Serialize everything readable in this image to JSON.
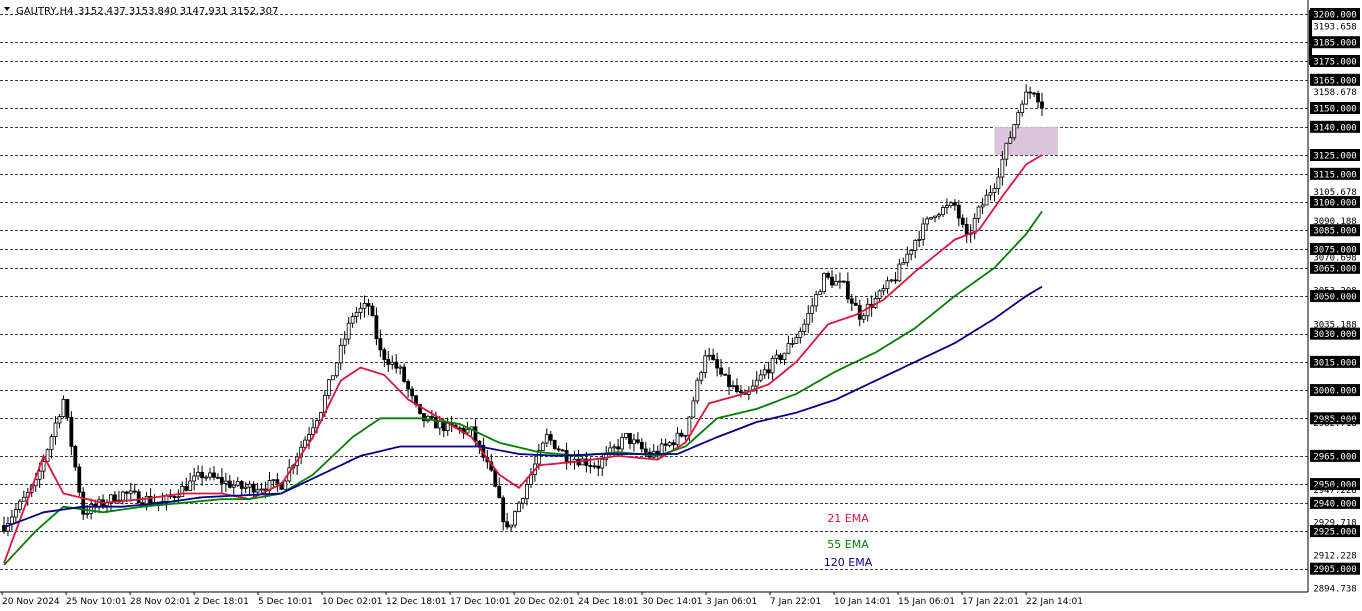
{
  "header": {
    "symbol": "GAUTRY,H4",
    "ohlc": "3152.437 3153.840 3147.931 3152.307"
  },
  "colors": {
    "ema21": "#dc143c",
    "ema55": "#008000",
    "ema120": "#00008b",
    "candle": "#000000",
    "zone": "#d8bfd8",
    "grid": "#000000",
    "axis_label_bg": "#000000"
  },
  "chart_data": {
    "type": "candlestick",
    "title": "GAUTRY,H4",
    "ylim": [
      2894.738,
      3200.0
    ],
    "grid": true,
    "x_tick_labels": [
      "20 Nov 2024",
      "25 Nov 10:01",
      "28 Nov 02:01",
      "2 Dec 18:01",
      "5 Dec 10:01",
      "10 Dec 02:01",
      "12 Dec 18:01",
      "17 Dec 10:01",
      "20 Dec 02:01",
      "24 Dec 18:01",
      "30 Dec 14:01",
      "3 Jan 06:01",
      "7 Jan 22:01",
      "10 Jan 14:01",
      "15 Jan 06:01",
      "17 Jan 22:01",
      "22 Jan 14:01"
    ],
    "level_lines": [
      3200,
      3185,
      3175,
      3165,
      3150,
      3140,
      3125,
      3115,
      3100,
      3085,
      3075,
      3065,
      3050,
      3030,
      3015,
      3000,
      2985,
      2965,
      2950,
      2940,
      2925,
      2905
    ],
    "highlighted_labels": [
      "3200.000",
      "3185.000",
      "3175.000",
      "3165.000",
      "3150.000",
      "3140.000",
      "3125.000",
      "3115.000",
      "3100.000",
      "3085.000",
      "3075.000",
      "3065.000",
      "3050.000",
      "3030.000",
      "3015.000",
      "3000.000",
      "2985.000",
      "2965.000",
      "2950.000",
      "2940.000",
      "2925.000",
      "2905.000"
    ],
    "plain_labels": [
      "3193.658",
      "3158.678",
      "3105.678",
      "3090.188",
      "3070.698",
      "3053.208",
      "3035.188",
      "2982.718",
      "2947.228",
      "2929.718",
      "2912.228",
      "2894.738"
    ],
    "price_key_points": [
      [
        0,
        2928
      ],
      [
        8,
        2950
      ],
      [
        15,
        2995
      ],
      [
        20,
        2935
      ],
      [
        30,
        2945
      ],
      [
        40,
        2940
      ],
      [
        50,
        2955
      ],
      [
        60,
        2948
      ],
      [
        70,
        2950
      ],
      [
        80,
        2990
      ],
      [
        88,
        3040
      ],
      [
        92,
        3045
      ],
      [
        95,
        3020
      ],
      [
        100,
        3010
      ],
      [
        105,
        2985
      ],
      [
        112,
        2980
      ],
      [
        118,
        2978
      ],
      [
        123,
        2955
      ],
      [
        127,
        2925
      ],
      [
        132,
        2950
      ],
      [
        137,
        2975
      ],
      [
        142,
        2965
      ],
      [
        150,
        2960
      ],
      [
        157,
        2975
      ],
      [
        163,
        2965
      ],
      [
        167,
        2970
      ],
      [
        172,
        2978
      ],
      [
        177,
        3020
      ],
      [
        182,
        3005
      ],
      [
        187,
        2995
      ],
      [
        192,
        3010
      ],
      [
        197,
        3020
      ],
      [
        202,
        3035
      ],
      [
        207,
        3060
      ],
      [
        212,
        3055
      ],
      [
        216,
        3040
      ],
      [
        220,
        3048
      ],
      [
        225,
        3060
      ],
      [
        230,
        3080
      ],
      [
        235,
        3095
      ],
      [
        240,
        3098
      ],
      [
        243,
        3080
      ],
      [
        246,
        3095
      ],
      [
        250,
        3110
      ],
      [
        254,
        3135
      ],
      [
        257,
        3155
      ],
      [
        260,
        3160
      ],
      [
        262,
        3152
      ]
    ],
    "ema_key_points": {
      "21 EMA": [
        [
          0,
          2908
        ],
        [
          10,
          2965
        ],
        [
          15,
          2945
        ],
        [
          25,
          2940
        ],
        [
          35,
          2942
        ],
        [
          45,
          2945
        ],
        [
          55,
          2945
        ],
        [
          62,
          2942
        ],
        [
          70,
          2950
        ],
        [
          78,
          2975
        ],
        [
          85,
          3005
        ],
        [
          90,
          3012
        ],
        [
          96,
          3008
        ],
        [
          102,
          2995
        ],
        [
          110,
          2985
        ],
        [
          118,
          2975
        ],
        [
          125,
          2955
        ],
        [
          130,
          2948
        ],
        [
          135,
          2960
        ],
        [
          145,
          2962
        ],
        [
          155,
          2965
        ],
        [
          165,
          2963
        ],
        [
          172,
          2972
        ],
        [
          178,
          2993
        ],
        [
          185,
          2997
        ],
        [
          193,
          3003
        ],
        [
          200,
          3015
        ],
        [
          208,
          3035
        ],
        [
          215,
          3040
        ],
        [
          222,
          3048
        ],
        [
          230,
          3063
        ],
        [
          240,
          3080
        ],
        [
          246,
          3085
        ],
        [
          252,
          3103
        ],
        [
          258,
          3120
        ],
        [
          262,
          3125
        ]
      ],
      "55 EMA": [
        [
          0,
          2907
        ],
        [
          8,
          2925
        ],
        [
          15,
          2938
        ],
        [
          25,
          2935
        ],
        [
          35,
          2938
        ],
        [
          45,
          2940
        ],
        [
          55,
          2942
        ],
        [
          62,
          2942
        ],
        [
          70,
          2945
        ],
        [
          78,
          2955
        ],
        [
          88,
          2975
        ],
        [
          95,
          2985
        ],
        [
          105,
          2985
        ],
        [
          115,
          2982
        ],
        [
          125,
          2972
        ],
        [
          135,
          2967
        ],
        [
          145,
          2965
        ],
        [
          155,
          2967
        ],
        [
          165,
          2965
        ],
        [
          172,
          2970
        ],
        [
          180,
          2985
        ],
        [
          190,
          2990
        ],
        [
          200,
          2998
        ],
        [
          210,
          3010
        ],
        [
          220,
          3020
        ],
        [
          230,
          3033
        ],
        [
          240,
          3050
        ],
        [
          250,
          3065
        ],
        [
          258,
          3083
        ],
        [
          262,
          3095
        ]
      ],
      "120 EMA": [
        [
          0,
          2927
        ],
        [
          10,
          2935
        ],
        [
          20,
          2938
        ],
        [
          30,
          2938
        ],
        [
          40,
          2940
        ],
        [
          50,
          2943
        ],
        [
          60,
          2944
        ],
        [
          70,
          2945
        ],
        [
          80,
          2955
        ],
        [
          90,
          2965
        ],
        [
          100,
          2970
        ],
        [
          110,
          2970
        ],
        [
          120,
          2970
        ],
        [
          130,
          2966
        ],
        [
          140,
          2965
        ],
        [
          150,
          2966
        ],
        [
          160,
          2966
        ],
        [
          170,
          2966
        ],
        [
          180,
          2975
        ],
        [
          190,
          2983
        ],
        [
          200,
          2988
        ],
        [
          210,
          2995
        ],
        [
          220,
          3005
        ],
        [
          230,
          3015
        ],
        [
          240,
          3025
        ],
        [
          250,
          3038
        ],
        [
          258,
          3050
        ],
        [
          262,
          3055
        ]
      ]
    },
    "zone": {
      "x_from": 250,
      "x_to": 266,
      "price_from": 3125,
      "price_to": 3140
    },
    "legend": [
      {
        "label": "21 EMA",
        "color": "#dc143c"
      },
      {
        "label": "55 EMA",
        "color": "#008000"
      },
      {
        "label": "120 EMA",
        "color": "#00008b"
      }
    ]
  }
}
